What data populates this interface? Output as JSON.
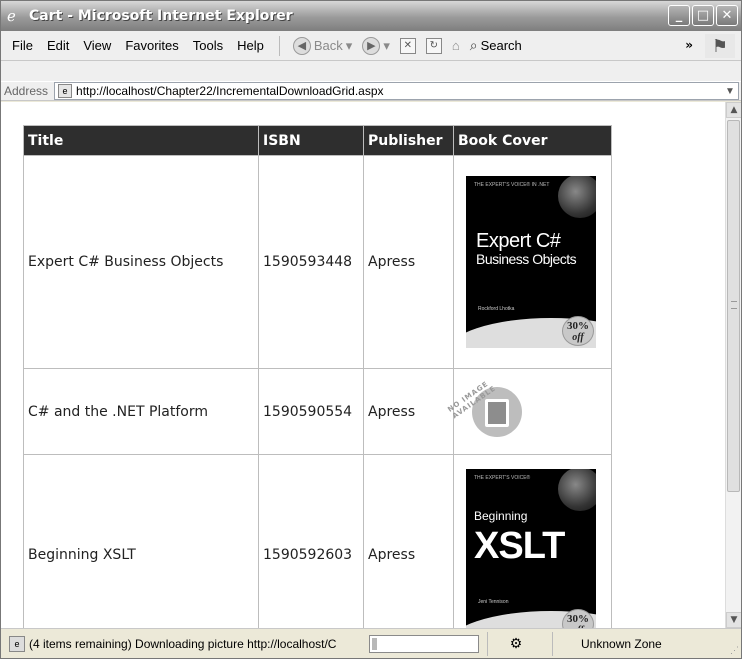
{
  "window": {
    "title": "Cart - Microsoft Internet Explorer"
  },
  "menu": {
    "items": [
      "File",
      "Edit",
      "View",
      "Favorites",
      "Tools",
      "Help"
    ]
  },
  "toolbar": {
    "back_label": "Back",
    "search_label": "Search"
  },
  "address": {
    "label": "Address",
    "url": "http://localhost/Chapter22/IncrementalDownloadGrid.aspx"
  },
  "grid": {
    "headers": {
      "title": "Title",
      "isbn": "ISBN",
      "publisher": "Publisher",
      "cover": "Book Cover"
    },
    "rows": [
      {
        "title": "Expert C# Business Objects",
        "isbn": "1590593448",
        "publisher": "Apress"
      },
      {
        "title": "C# and the .NET Platform",
        "isbn": "1590590554",
        "publisher": "Apress"
      },
      {
        "title": "Beginning XSLT",
        "isbn": "1590592603",
        "publisher": "Apress"
      }
    ]
  },
  "covers": {
    "cover1_line1": "Expert C#",
    "cover1_line2": "Business Objects",
    "cover1_tag": "THE EXPERT'S VOICE® IN .NET",
    "cover1_author": "Rockford Lhotka",
    "cover1_badge": "30%",
    "cover1_badge_off": "off",
    "noimage_text": "NO IMAGE AVAILABLE",
    "cover3_tag": "THE EXPERT'S VOICE®",
    "cover3_line1": "Beginning",
    "cover3_line2": "XSLT",
    "cover3_author": "Jeni Tennison",
    "cover3_badge": "30%",
    "cover3_badge_off": "off"
  },
  "status": {
    "text": "(4 items remaining) Downloading picture http://localhost/C",
    "progress": 0.05,
    "zone": "Unknown Zone"
  }
}
